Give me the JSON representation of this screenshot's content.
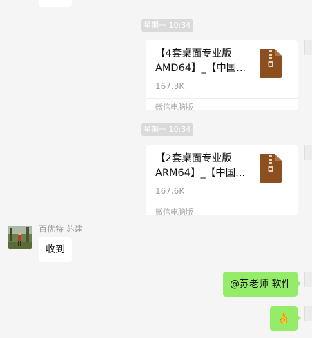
{
  "messages": {
    "file1": {
      "timestamp": "星期一 10:34",
      "title_line1": "【4套桌面专业版",
      "title_line2": "AMD64】_【中国...",
      "size": "167.3K",
      "source": "微信电脑版"
    },
    "file2": {
      "timestamp": "星期一 10:34",
      "title_line1": "【2套桌面专业版",
      "title_line2": "ARM64】_【中国...",
      "size": "167.6K",
      "source": "微信电脑版"
    },
    "received": {
      "sender": "百优特 苏建",
      "text": "收到"
    },
    "sent1": {
      "text": "@苏老师 软件"
    },
    "sent2": {
      "emoji": "👌"
    }
  },
  "colors": {
    "background": "#f5f5f5",
    "sent_bubble": "#95ec69",
    "received_bubble": "#ffffff",
    "zip_brown": "#8b4f20"
  }
}
